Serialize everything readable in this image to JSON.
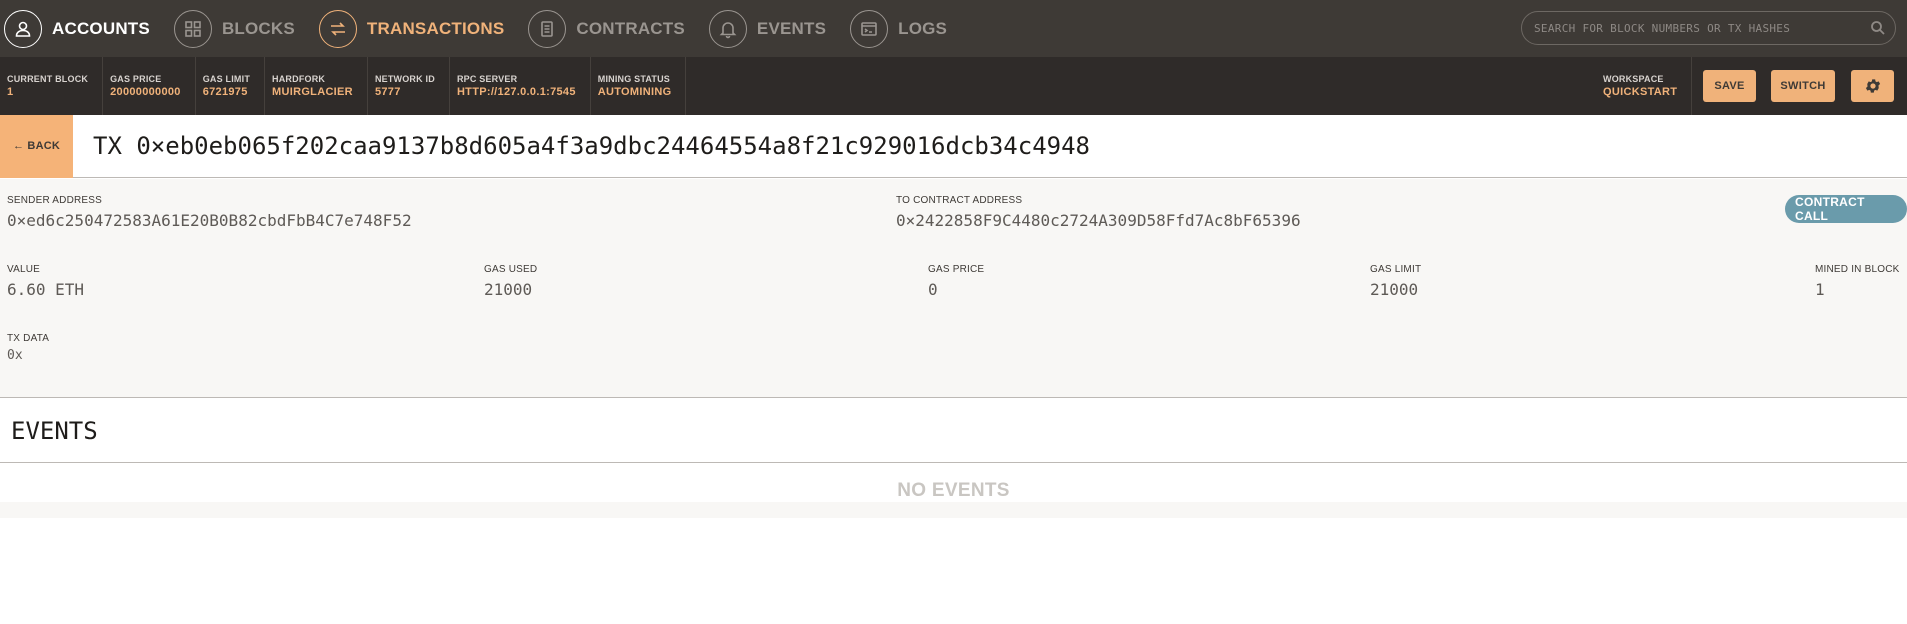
{
  "nav": {
    "items": [
      {
        "label": "ACCOUNTS",
        "icon": "person-icon"
      },
      {
        "label": "BLOCKS",
        "icon": "grid-icon"
      },
      {
        "label": "TRANSACTIONS",
        "icon": "swap-arrows-icon"
      },
      {
        "label": "CONTRACTS",
        "icon": "document-icon"
      },
      {
        "label": "EVENTS",
        "icon": "bell-icon"
      },
      {
        "label": "LOGS",
        "icon": "terminal-icon"
      }
    ],
    "search_placeholder": "SEARCH FOR BLOCK NUMBERS OR TX HASHES"
  },
  "status": {
    "current_block": {
      "label": "CURRENT BLOCK",
      "value": "1"
    },
    "gas_price": {
      "label": "GAS PRICE",
      "value": "20000000000"
    },
    "gas_limit": {
      "label": "GAS LIMIT",
      "value": "6721975"
    },
    "hardfork": {
      "label": "HARDFORK",
      "value": "MUIRGLACIER"
    },
    "network_id": {
      "label": "NETWORK ID",
      "value": "5777"
    },
    "rpc_server": {
      "label": "RPC SERVER",
      "value": "HTTP://127.0.0.1:7545"
    },
    "mining_status": {
      "label": "MINING STATUS",
      "value": "AUTOMINING"
    },
    "workspace": {
      "label": "WORKSPACE",
      "value": "QUICKSTART"
    },
    "save_label": "SAVE",
    "switch_label": "SWITCH"
  },
  "tx": {
    "back_label": "← BACK",
    "title": "TX 0×eb0eb065f202caa9137b8d605a4f3a9dbc24464554a8f21c929016dcb34c4948",
    "sender": {
      "label": "SENDER ADDRESS",
      "value": "0×ed6c250472583A61E20B0B82cbdFbB4C7e748F52"
    },
    "to_contract": {
      "label": "TO CONTRACT ADDRESS",
      "value": "0×2422858F9C4480c2724A309D58Ffd7Ac8bF65396"
    },
    "badge": "CONTRACT CALL",
    "value": {
      "label": "VALUE",
      "value": "6.60 ETH"
    },
    "gas_used": {
      "label": "GAS USED",
      "value": "21000"
    },
    "gas_price": {
      "label": "GAS PRICE",
      "value": "0"
    },
    "gas_limit": {
      "label": "GAS LIMIT",
      "value": "21000"
    },
    "mined_in_block": {
      "label": "MINED IN BLOCK",
      "value": "1"
    },
    "tx_data": {
      "label": "TX DATA",
      "value": "0x"
    }
  },
  "events": {
    "title": "EVENTS",
    "empty_text": "NO EVENTS"
  },
  "colors": {
    "nav_bg": "#3e3a36",
    "status_bg": "#2f2b29",
    "accent_orange": "#f0b27a",
    "badge_blue": "#6a9bab",
    "details_bg": "#f8f7f5"
  }
}
